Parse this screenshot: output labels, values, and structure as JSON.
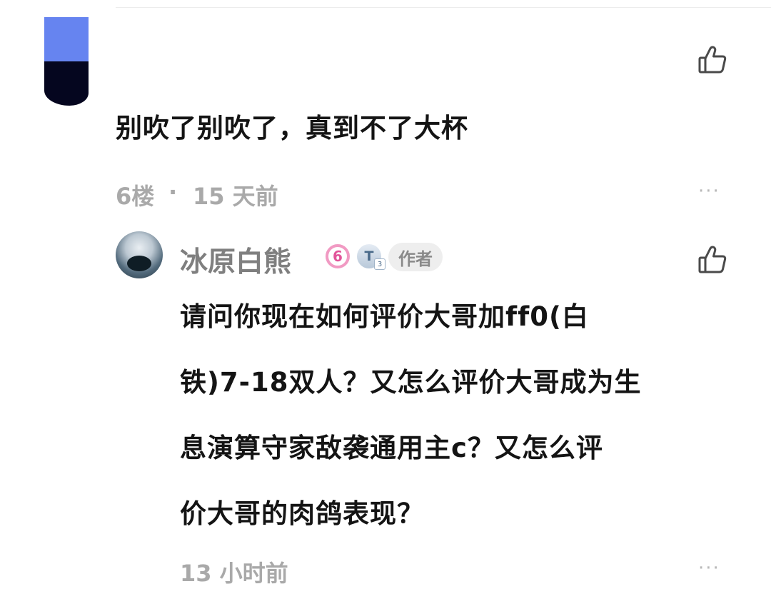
{
  "comment": {
    "text": "别吹了别吹了，真到不了大杯",
    "floor": "6楼",
    "separator": "·",
    "time": "15 天前",
    "like_icon": "thumbs-up-icon",
    "more_icon": "more-horizontal-icon",
    "more_glyph": "···",
    "avatar_colors": [
      "#6684f0",
      "#05061f"
    ]
  },
  "reply": {
    "username": "冰原白熊",
    "level_badge": "6",
    "title_badge": "T",
    "title_badge_sub": "3",
    "author_tag": "作者",
    "lines": [
      "请问你现在如何评价大哥加ff0(白",
      "铁)7-18双人？又怎么评价大哥成为生",
      "息演算守家敌袭通用主c？又怎么评",
      "价大哥的肉鸽表现？"
    ],
    "time": "13 小时前",
    "like_icon": "thumbs-up-icon",
    "more_icon": "more-horizontal-icon",
    "more_glyph": "···"
  }
}
